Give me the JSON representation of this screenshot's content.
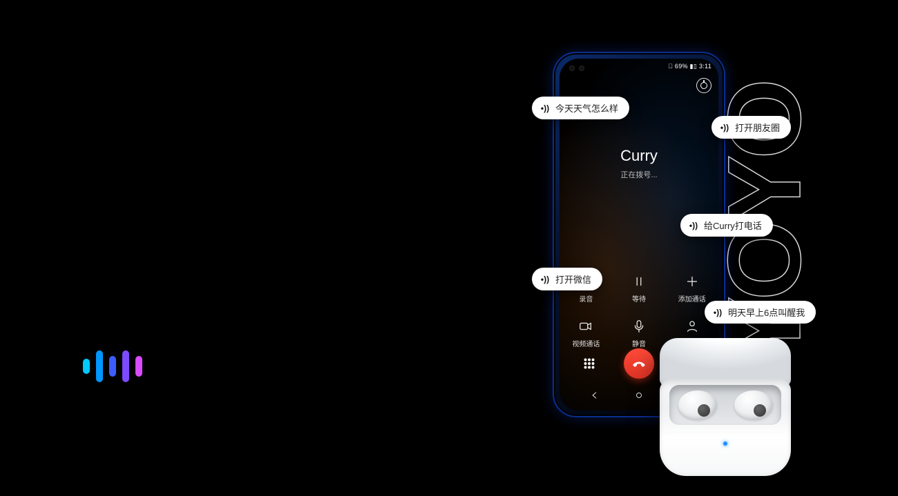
{
  "status": {
    "signal_battery_time": "􀙇 69% ▮▯ 3:11"
  },
  "call": {
    "name": "Curry",
    "state": "正在拨号..."
  },
  "actions": {
    "record": "录音",
    "hold": "等待",
    "add": "添加通话",
    "video": "视频通话",
    "mute": "静音",
    "contacts": "联系人"
  },
  "bubbles": {
    "b1": "今天天气怎么样",
    "b2": "打开朋友圈",
    "b3": "给Curry打电话",
    "b4": "打开微信",
    "b5": "明天早上6点叫醒我"
  },
  "brand": "YOYO"
}
